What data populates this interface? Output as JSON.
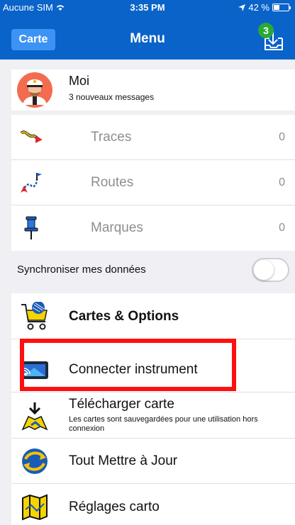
{
  "status_bar": {
    "carrier": "Aucune SIM",
    "time": "3:35 PM",
    "battery": "42 %",
    "battery_level": 0.42
  },
  "nav": {
    "back_label": "Carte",
    "title": "Menu",
    "download_badge": "3"
  },
  "profile": {
    "name": "Moi",
    "subtitle": "3 nouveaux messages"
  },
  "counts": [
    {
      "label": "Traces",
      "value": "0",
      "icon": "traces-icon"
    },
    {
      "label": "Routes",
      "value": "0",
      "icon": "routes-icon"
    },
    {
      "label": "Marques",
      "value": "0",
      "icon": "pin-icon"
    }
  ],
  "sync": {
    "label": "Synchroniser mes données",
    "enabled": false
  },
  "menu": [
    {
      "label": "Cartes & Options",
      "icon": "shopping-cart-icon"
    },
    {
      "label": "Connecter instrument",
      "icon": "instrument-icon"
    },
    {
      "label": "Télécharger carte",
      "subtitle": "Les cartes sont sauvegardées pour une utilisation hors connexion",
      "icon": "download-map-icon"
    },
    {
      "label": "Tout Mettre à Jour",
      "icon": "update-icon"
    },
    {
      "label": "Réglages carto",
      "icon": "map-settings-icon"
    }
  ],
  "colors": {
    "nav_blue": "#0a63c9",
    "button_blue": "#3d93f5",
    "badge_green": "#2aa836",
    "highlight_red": "#ff1010"
  }
}
